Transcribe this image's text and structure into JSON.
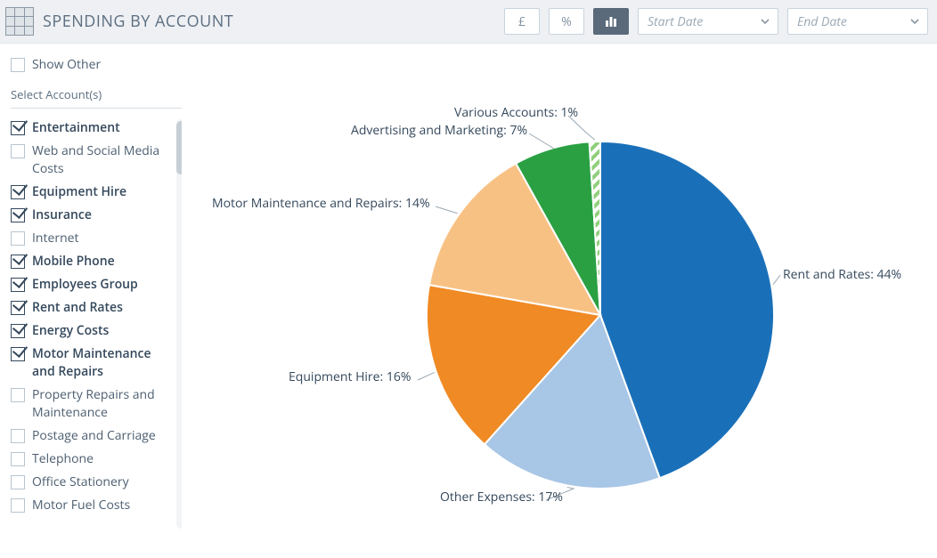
{
  "header": {
    "title": "SPENDING BY ACCOUNT",
    "currency_label": "£",
    "percent_label": "%",
    "start_date_placeholder": "Start Date",
    "end_date_placeholder": "End Date"
  },
  "filters": {
    "show_other_label": "Show Other",
    "select_accounts_label": "Select Account(s)",
    "accounts": [
      {
        "label": "Entertainment",
        "checked": true
      },
      {
        "label": "Web and Social Media Costs",
        "checked": false
      },
      {
        "label": "Equipment Hire",
        "checked": true
      },
      {
        "label": "Insurance",
        "checked": true
      },
      {
        "label": "Internet",
        "checked": false
      },
      {
        "label": "Mobile Phone",
        "checked": true
      },
      {
        "label": "Employees Group",
        "checked": true
      },
      {
        "label": "Rent and Rates",
        "checked": true
      },
      {
        "label": "Energy Costs",
        "checked": true
      },
      {
        "label": "Motor Maintenance and Repairs",
        "checked": true
      },
      {
        "label": "Property Repairs and Maintenance",
        "checked": false
      },
      {
        "label": "Postage and Carriage",
        "checked": false
      },
      {
        "label": "Telephone",
        "checked": false
      },
      {
        "label": "Office Stationery",
        "checked": false
      },
      {
        "label": "Motor Fuel Costs",
        "checked": false
      }
    ]
  },
  "chart_data": {
    "type": "pie",
    "title": "",
    "series": [
      {
        "name": "Rent and Rates",
        "value": 44,
        "color": "#1a70b8",
        "label": "Rent and Rates: 44%"
      },
      {
        "name": "Other Expenses",
        "value": 17,
        "color": "#a8c6e6",
        "label": "Other Expenses: 17%"
      },
      {
        "name": "Equipment Hire",
        "value": 16,
        "color": "#f08a24",
        "label": "Equipment Hire: 16%"
      },
      {
        "name": "Motor Maintenance and Repairs",
        "value": 14,
        "color": "#f8c184",
        "label": "Motor Maintenance and Repairs: 14%"
      },
      {
        "name": "Advertising and Marketing",
        "value": 7,
        "color": "#2aa043",
        "label": "Advertising and Marketing: 7%"
      },
      {
        "name": "Various Accounts",
        "value": 1,
        "color": "#8fcf7a",
        "label": "Various Accounts: 1%",
        "pattern": "hatch"
      }
    ]
  }
}
